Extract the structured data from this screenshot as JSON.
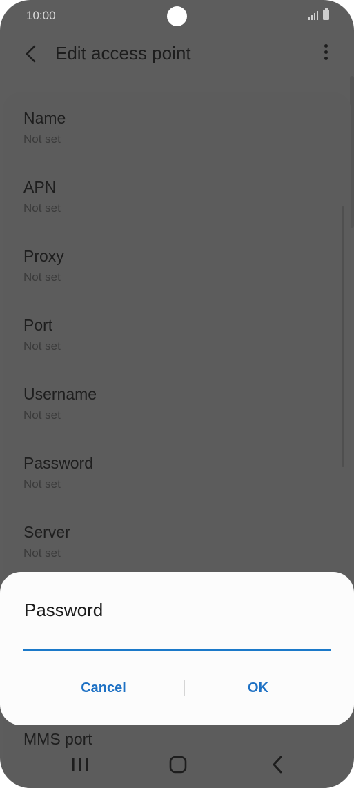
{
  "status_bar": {
    "time": "10:00"
  },
  "app_bar": {
    "title": "Edit access point"
  },
  "list": {
    "items": [
      {
        "label": "Name",
        "value": "Not set"
      },
      {
        "label": "APN",
        "value": "Not set"
      },
      {
        "label": "Proxy",
        "value": "Not set"
      },
      {
        "label": "Port",
        "value": "Not set"
      },
      {
        "label": "Username",
        "value": "Not set"
      },
      {
        "label": "Password",
        "value": "Not set"
      },
      {
        "label": "Server",
        "value": "Not set"
      }
    ],
    "partial_item_label": "MMS port"
  },
  "dialog": {
    "title": "Password",
    "input_value": "",
    "cancel_label": "Cancel",
    "ok_label": "OK"
  },
  "colors": {
    "accent": "#1e71c4",
    "dim_background": "#5d5d5d",
    "dialog_background": "#fcfcfc"
  },
  "icons": {
    "back": "back-arrow-icon",
    "more": "more-vert-icon",
    "nav_recents": "recents-icon",
    "nav_home": "home-icon",
    "nav_back": "nav-back-icon"
  }
}
